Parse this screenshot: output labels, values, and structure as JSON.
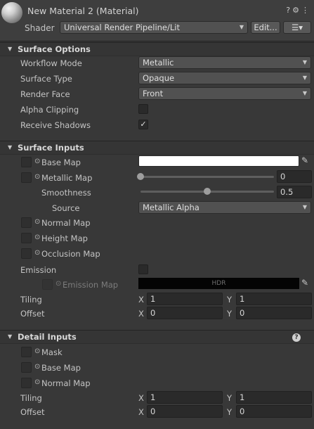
{
  "header": {
    "title": "New Material 2 (Material)",
    "shader_label": "Shader",
    "shader_value": "Universal Render Pipeline/Lit",
    "edit_button": "Edit...",
    "icons": [
      "help-icon",
      "settings-icon",
      "more-icon",
      "list-icon"
    ]
  },
  "surface_options": {
    "title": "Surface Options",
    "rows": {
      "workflow_mode": {
        "label": "Workflow Mode",
        "value": "Metallic"
      },
      "surface_type": {
        "label": "Surface Type",
        "value": "Opaque"
      },
      "render_face": {
        "label": "Render Face",
        "value": "Front"
      },
      "alpha_clipping": {
        "label": "Alpha Clipping",
        "checked": false
      },
      "receive_shadows": {
        "label": "Receive Shadows",
        "checked": true,
        "check_glyph": "✓"
      }
    }
  },
  "surface_inputs": {
    "title": "Surface Inputs",
    "base_map": {
      "label": "Base Map",
      "color": "#ffffff"
    },
    "metallic_map": {
      "label": "Metallic Map",
      "value": "0",
      "fraction": 0.0
    },
    "smoothness": {
      "label": "Smoothness",
      "value": "0.5",
      "fraction": 0.5
    },
    "source": {
      "label": "Source",
      "value": "Metallic Alpha"
    },
    "normal_map": {
      "label": "Normal Map"
    },
    "height_map": {
      "label": "Height Map"
    },
    "occlusion_map": {
      "label": "Occlusion Map"
    },
    "emission": {
      "label": "Emission",
      "checked": false
    },
    "emission_map": {
      "label": "Emission Map",
      "hdr_label": "HDR",
      "color": "#040404"
    },
    "tiling": {
      "label": "Tiling",
      "x_label": "X",
      "x": "1",
      "y_label": "Y",
      "y": "1"
    },
    "offset": {
      "label": "Offset",
      "x_label": "X",
      "x": "0",
      "y_label": "Y",
      "y": "0"
    }
  },
  "detail_inputs": {
    "title": "Detail Inputs",
    "mask": {
      "label": "Mask"
    },
    "base_map": {
      "label": "Base Map"
    },
    "normal_map": {
      "label": "Normal Map"
    },
    "tiling": {
      "label": "Tiling",
      "x_label": "X",
      "x": "1",
      "y_label": "Y",
      "y": "1"
    },
    "offset": {
      "label": "Offset",
      "x_label": "X",
      "x": "0",
      "y_label": "Y",
      "y": "0"
    }
  },
  "glyphs": {
    "foldout": "▼",
    "dropdown_arrow": "▼",
    "picker": "⊙",
    "eyedropper": "✎",
    "help": "?",
    "header_icons": "?⚙⋮",
    "list_icon": "☰▾"
  }
}
